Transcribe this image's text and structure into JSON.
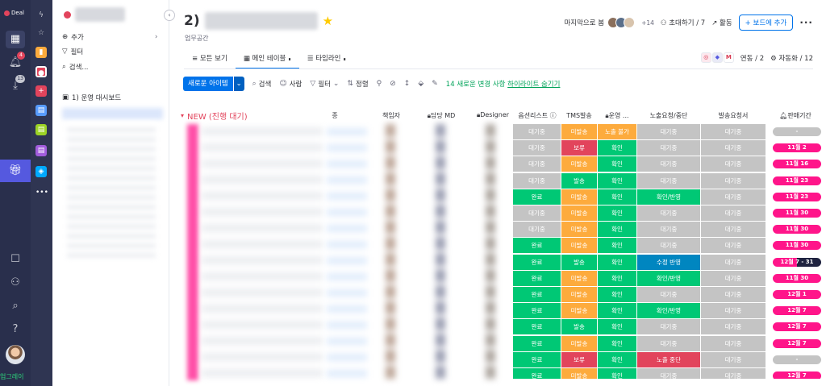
{
  "rail": {
    "logo_text": "Deal",
    "notif_badge": "4",
    "inbox_badge": "13",
    "upgrade": "업그레이"
  },
  "workspace_icons": [
    "lightning-icon",
    "star-icon",
    "folder-icon",
    "board-icon",
    "plus-icon",
    "board-icon",
    "board-icon",
    "board-icon",
    "shield-icon",
    "more-icon"
  ],
  "sidebar": {
    "collapse": "‹",
    "add": "추가",
    "filter": "필터",
    "search": "검색...",
    "board_item": "1) 운영 대시보드"
  },
  "header": {
    "title_prefix": "2)",
    "subtitle": "업무공간",
    "last_seen": "마지막으로 봄",
    "members_more": "+14",
    "invite": "초대하기 / 7",
    "activity": "활동",
    "add_to_board": "+ 보드에 추가"
  },
  "tabs": [
    {
      "label": "모든 보기",
      "icon": "≡"
    },
    {
      "label": "메인 테이블",
      "icon": "▦",
      "pin": "∎"
    },
    {
      "label": "타임라인",
      "icon": "☰",
      "pin": "∎"
    }
  ],
  "integrations": {
    "label": "연동 / 2",
    "automations": "자동화 / 12"
  },
  "toolbar": {
    "new_item": "새로운 아이템",
    "search": "검색",
    "person": "사람",
    "filter": "필터",
    "sort": "정렬",
    "changes_prefix": "14 새로운 변경 사항",
    "changes_link": "하이라이트 숨기기"
  },
  "group": {
    "title": "NEW (진행 대기)"
  },
  "columns": {
    "c0": "종",
    "c1": "책임자",
    "c2": "담당 MD",
    "c3": "Designer",
    "c4": "옵션리스트 ⓘ",
    "c5": "TMS발송",
    "c6": "운영 ...",
    "c7": "노출요청/중단",
    "c8": "발송요청서",
    "c9": "판매기간"
  },
  "rows": [
    {
      "opt": "대기중",
      "tms": "미발송",
      "ops": "노출 불가",
      "exp": "대기중",
      "send": "대기중",
      "date": "-"
    },
    {
      "opt": "대기중",
      "tms": "보류",
      "ops": "확인",
      "exp": "대기중",
      "send": "대기중",
      "date": "11월 2"
    },
    {
      "opt": "대기중",
      "tms": "미발송",
      "ops": "확인",
      "exp": "대기중",
      "send": "대기중",
      "date": "11월 16"
    },
    {
      "opt": "대기중",
      "tms": "발송",
      "ops": "확인",
      "exp": "대기중",
      "send": "대기중",
      "date": "11월 23"
    },
    {
      "opt": "완료",
      "tms": "미발송",
      "ops": "확인",
      "exp": "확인/반영",
      "send": "대기중",
      "date": "11월 23"
    },
    {
      "opt": "대기중",
      "tms": "미발송",
      "ops": "확인",
      "exp": "대기중",
      "send": "대기중",
      "date": "11월 30"
    },
    {
      "opt": "대기중",
      "tms": "미발송",
      "ops": "확인",
      "exp": "대기중",
      "send": "대기중",
      "date": "11월 30"
    },
    {
      "opt": "완료",
      "tms": "미발송",
      "ops": "확인",
      "exp": "대기중",
      "send": "대기중",
      "date": "11월 30"
    },
    {
      "opt": "완료",
      "tms": "발송",
      "ops": "확인",
      "exp": "수정 반영",
      "send": "대기중",
      "date": "12월 7 - 31"
    },
    {
      "opt": "완료",
      "tms": "미발송",
      "ops": "확인",
      "exp": "확인/반영",
      "send": "대기중",
      "date": "11월 30"
    },
    {
      "opt": "완료",
      "tms": "미발송",
      "ops": "확인",
      "exp": "대기중",
      "send": "대기중",
      "date": "12월 1"
    },
    {
      "opt": "완료",
      "tms": "미발송",
      "ops": "확인",
      "exp": "확인/반영",
      "send": "대기중",
      "date": "12월 7"
    },
    {
      "opt": "완료",
      "tms": "발송",
      "ops": "확인",
      "exp": "대기중",
      "send": "대기중",
      "date": "12월 7"
    },
    {
      "opt": "완료",
      "tms": "미발송",
      "ops": "확인",
      "exp": "대기중",
      "send": "대기중",
      "date": "12월 7"
    },
    {
      "opt": "완료",
      "tms": "보류",
      "ops": "확인",
      "exp": "노출 중단",
      "send": "대기중",
      "date": "-"
    },
    {
      "opt": "완료",
      "tms": "미발송",
      "ops": "확인",
      "exp": "대기중",
      "send": "대기중",
      "date": "12월 7"
    }
  ],
  "status_colors": {
    "대기중": "#c4c4c4",
    "완료": "#00c875",
    "미발송": "#fdab3d",
    "보류": "#e2445c",
    "발송": "#00c875",
    "확인": "#00c875",
    "노출 불가": "#fdab3d",
    "확인/반영": "#00c875",
    "수정 반영": "#0086c0",
    "노출 중단": "#e2445c"
  }
}
